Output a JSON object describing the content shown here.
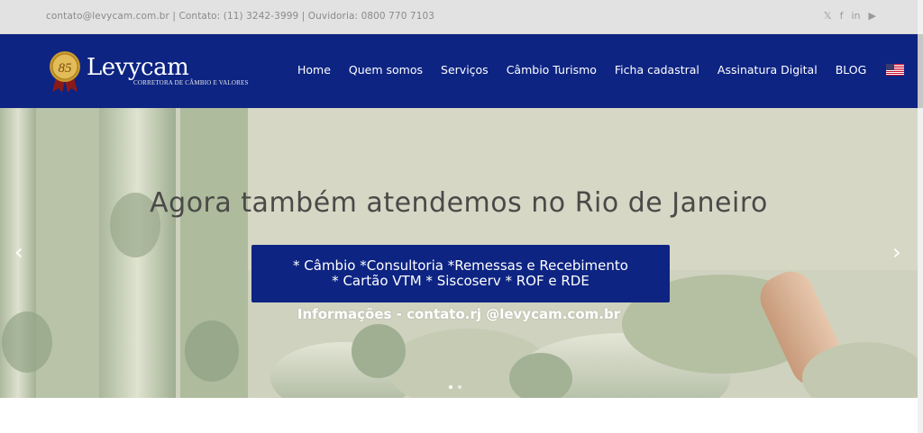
{
  "topbar": {
    "contact_text": "contato@levycam.com.br | Contato: (11) 3242-3999 | Ouvidoria: 0800 770 7103",
    "social": [
      {
        "icon": "twitter-icon",
        "glyph": "𝕏"
      },
      {
        "icon": "facebook-icon",
        "glyph": "f"
      },
      {
        "icon": "linkedin-icon",
        "glyph": "in"
      },
      {
        "icon": "youtube-icon",
        "glyph": "▶"
      }
    ]
  },
  "header": {
    "logo_badge": "85",
    "brand": "Levycam",
    "tagline": "CORRETORA DE CÂMBIO E VALORES",
    "nav": [
      {
        "label": "Home"
      },
      {
        "label": "Quem somos"
      },
      {
        "label": "Serviços"
      },
      {
        "label": "Câmbio Turismo"
      },
      {
        "label": "Ficha cadastral"
      },
      {
        "label": "Assinatura Digital"
      },
      {
        "label": "BLOG"
      }
    ],
    "flag_icon": "us-flag-icon"
  },
  "hero": {
    "title": "Agora também atendemos no Rio de Janeiro",
    "box_line1": "* Câmbio *Consultoria *Remessas e Recebimento",
    "box_line2": "* Cartão VTM * Siscoserv * ROF e RDE",
    "info": "Informações - contato.rj @levycam.com.br",
    "prev_arrow": "‹",
    "next_arrow": "›"
  },
  "colors": {
    "brand_blue": "#0d2483",
    "topbar_bg": "#e2e2e2",
    "hero_text": "#4a4a48"
  }
}
